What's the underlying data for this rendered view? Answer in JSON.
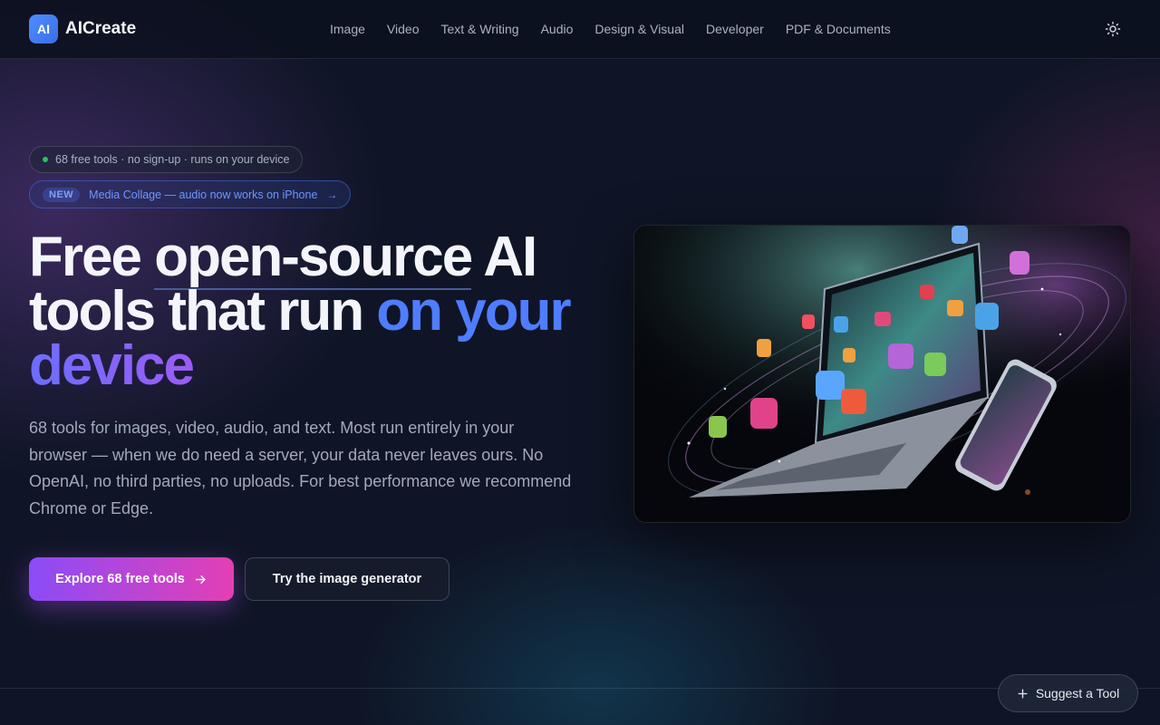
{
  "app": {
    "logo_mark": "AI",
    "name": "AICreate"
  },
  "nav": {
    "items": [
      {
        "label": "Image"
      },
      {
        "label": "Video"
      },
      {
        "label": "Text & Writing"
      },
      {
        "label": "Audio"
      },
      {
        "label": "Design & Visual"
      },
      {
        "label": "Developer"
      },
      {
        "label": "PDF & Documents"
      }
    ],
    "theme_toggle_icon": "sun-icon"
  },
  "hero": {
    "status_pill": "68 free tools · no sign-up · runs on your device",
    "announcement": {
      "badge": "NEW",
      "text": "Media Collage — audio now works on iPhone",
      "arrow": "→"
    },
    "title": {
      "part1": "Free ",
      "part2_underlined": "open-source",
      "part3": " AI",
      "line2_plain": "tools that run ",
      "line2_highlight": "on your",
      "line3_highlight": "device"
    },
    "description": "68 tools for images, video, audio, and text. Most run entirely in your browser — when we do need a server, your data never leaves ours. No OpenAI, no third parties, no uploads. For best performance we recommend Chrome or Edge.",
    "primary_button": "Explore 68 free tools",
    "secondary_button": "Try the image generator",
    "image_icon": "devices-illustration-icon"
  },
  "footer_actions": {
    "suggest_button": "Suggest a Tool"
  },
  "colors": {
    "accent_blue": "#4f7dff",
    "accent_purple": "#8b4cf7",
    "accent_pink": "#e43fb4",
    "status_green": "#22c55e",
    "background": "#0f1526"
  }
}
